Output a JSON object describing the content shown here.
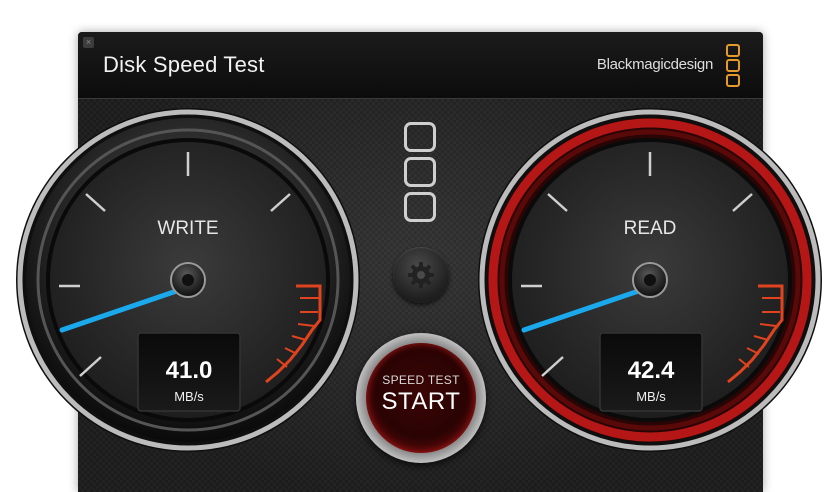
{
  "window": {
    "title": "Disk Speed Test",
    "brand": "Blackmagicdesign",
    "close_glyph": "×"
  },
  "colors": {
    "needle": "#1ba9ee",
    "redline": "#e0431e",
    "read_ring": "#9c1313",
    "brand_logo": "#e79a2c"
  },
  "icons": {
    "close": "close-icon",
    "brand_logo": "blackmagic-logo-icon",
    "center_logo": "blackmagic-logo-icon",
    "settings": "gear-icon"
  },
  "gauges": {
    "write": {
      "label": "WRITE",
      "value": "41.0",
      "unit": "MB/s"
    },
    "read": {
      "label": "READ",
      "value": "42.4",
      "unit": "MB/s"
    }
  },
  "start_button": {
    "small_label": "SPEED TEST",
    "big_label": "START"
  }
}
